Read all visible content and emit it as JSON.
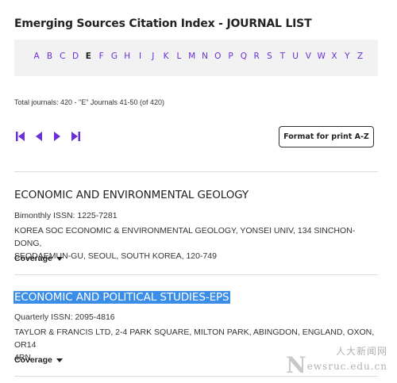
{
  "header": {
    "title": "Emerging Sources Citation Index - JOURNAL LIST"
  },
  "alphabet": {
    "letters": [
      "A",
      "B",
      "C",
      "D",
      "E",
      "F",
      "G",
      "H",
      "I",
      "J",
      "K",
      "L",
      "M",
      "N",
      "O",
      "P",
      "Q",
      "R",
      "S",
      "T",
      "U",
      "V",
      "W",
      "X",
      "Y",
      "Z"
    ],
    "active": "E",
    "link_color": "#6b2fd6"
  },
  "summary": {
    "text": "Total journals:  420 - \"E\" Journals 41-50 (of 420)"
  },
  "pager": {
    "icons": [
      "first-page-icon",
      "prev-page-icon",
      "next-page-icon",
      "last-page-icon"
    ]
  },
  "toolbar": {
    "print_label": "Format for print A-Z"
  },
  "journals": [
    {
      "title": "ECONOMIC AND ENVIRONMENTAL GEOLOGY",
      "meta": "Bimonthly ISSN: 1225-7281",
      "address_line1": "KOREA SOC ECONOMIC & ENVIRONMENTAL GEOLOGY, YONSEI UNIV, 134 SINCHON-DONG,",
      "address_line2": "SEODAEMUN-GU, SEOUL, SOUTH KOREA, 120-749",
      "coverage": "Coverage"
    },
    {
      "title": "ECONOMIC AND POLITICAL STUDIES-EPS",
      "meta": "Quarterly ISSN: 2095-4816",
      "address_line1": "TAYLOR & FRANCIS LTD, 2-4 PARK SQUARE, MILTON PARK, ABINGDON, ENGLAND, OXON, OR14",
      "address_line2": "4RN",
      "coverage": "Coverage"
    }
  ],
  "watermark": {
    "n": "N",
    "cn": "人大新闻网",
    "url": "ewsruc.edu.cn"
  }
}
